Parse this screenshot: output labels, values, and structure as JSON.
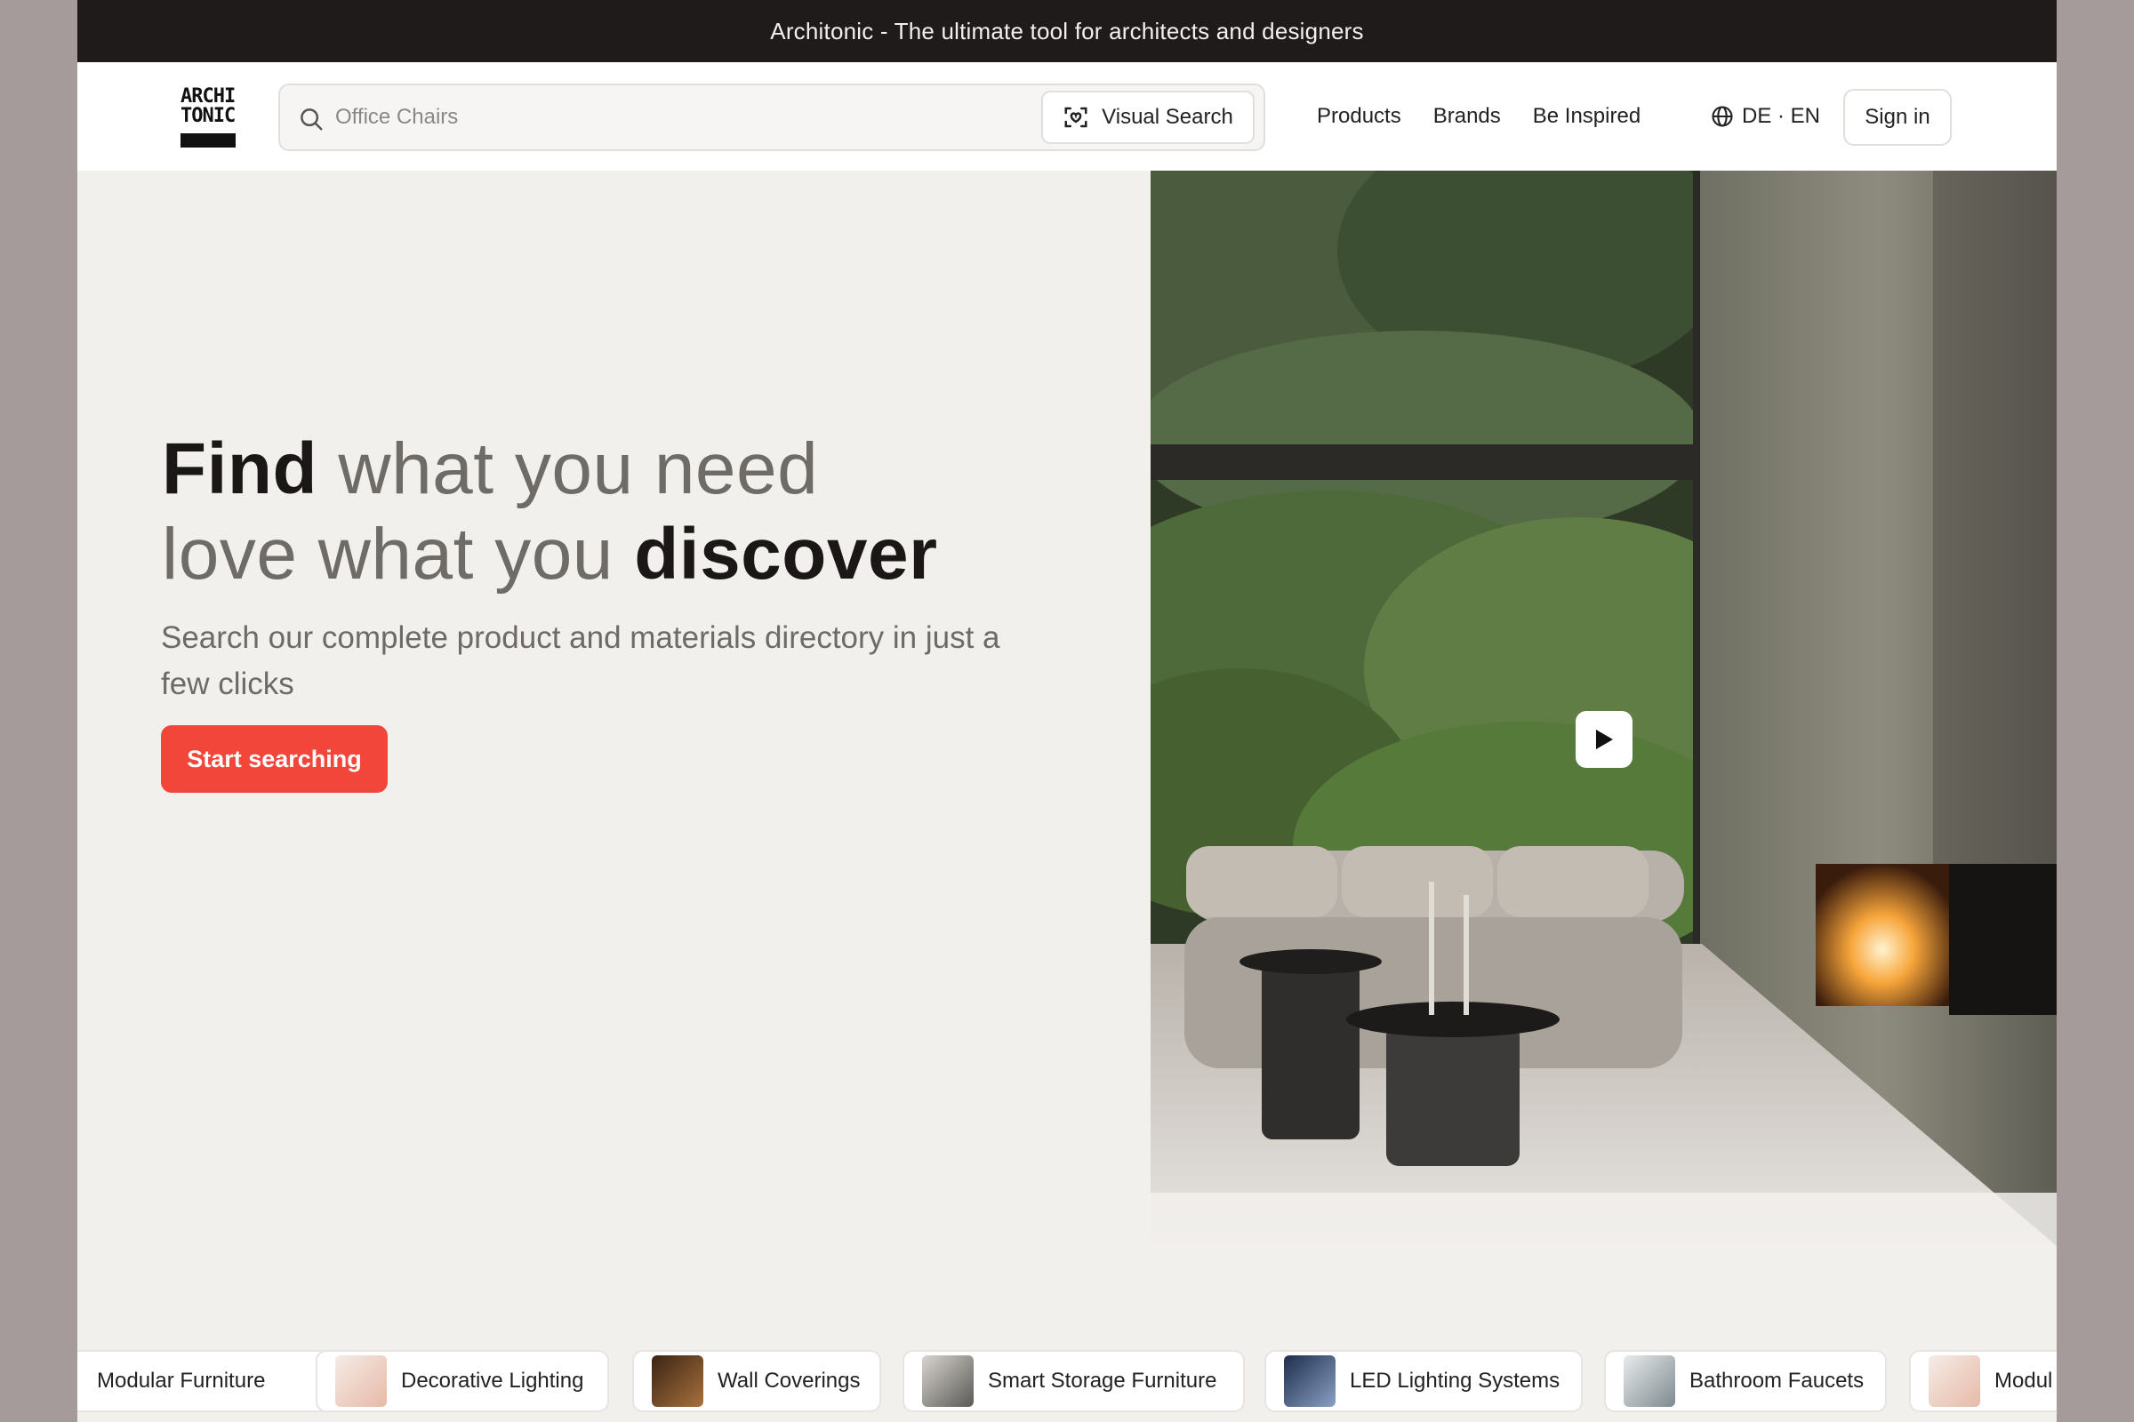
{
  "topbar": {
    "text": "Architonic - The ultimate tool for architects and designers"
  },
  "logo": {
    "line1": "ARCHI",
    "line2": "TONIC"
  },
  "search": {
    "placeholder": "Office Chairs",
    "visual_label": "Visual Search"
  },
  "nav": {
    "items": [
      {
        "label": "Products"
      },
      {
        "label": "Brands"
      },
      {
        "label": "Be Inspired"
      }
    ]
  },
  "lang": {
    "label": "DE · EN"
  },
  "signin": {
    "label": "Sign in"
  },
  "hero": {
    "h1_bold": "Find",
    "h1_rest": " what you need",
    "h2_rest": "love what you ",
    "h2_bold": "discover",
    "sub": "Search our complete product and materials directory in just a few clicks",
    "cta": "Start searching"
  },
  "chips": [
    {
      "label": "Modular Furniture"
    },
    {
      "label": "Decorative Lighting"
    },
    {
      "label": "Wall Coverings"
    },
    {
      "label": "Smart Storage Furniture"
    },
    {
      "label": "LED Lighting Systems"
    },
    {
      "label": "Bathroom Faucets"
    },
    {
      "label": "Modul"
    }
  ],
  "colors": {
    "accent": "#f2463a",
    "topbar": "#1e1b1a",
    "hero_bg": "#f2f0ed"
  }
}
